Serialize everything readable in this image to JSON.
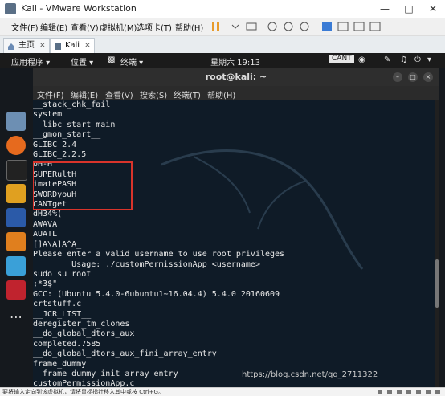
{
  "window": {
    "title": "Kali - VMware Workstation"
  },
  "vm_menu": {
    "items": [
      "文件(F)",
      "编辑(E)",
      "查看(V)",
      "虚拟机(M)",
      "选项卡(T)",
      "帮助(H)"
    ]
  },
  "tabs": [
    {
      "label": "主页"
    },
    {
      "label": "Kali"
    }
  ],
  "kali_panel": {
    "applications": "应用程序 ▾",
    "places": "位置 ▾",
    "terminal": "终端 ▾",
    "clock": "星期六 19:13"
  },
  "terminal": {
    "title": "root@kali: ~",
    "menu": [
      "文件(F)",
      "编辑(E)",
      "查看(V)",
      "搜索(S)",
      "终端(T)",
      "帮助(H)"
    ],
    "lines": [
      "__stack_chk_fail",
      "system",
      "__libc_start_main",
      "__gmon_start__",
      "GLIBC_2.4",
      "GLIBC_2.2.5",
      "UH-H",
      "SUPERultH",
      "imatePASH",
      "SWORDyouH",
      "CANTget",
      "dH34%(",
      "AWAVA",
      "AUATL",
      "[]A\\A]A^A_",
      "Please enter a valid username to use root privileges",
      "        Usage: ./customPermissionApp <username>",
      "sudo su root",
      ";*3$\"",
      "GCC: (Ubuntu 5.4.0-6ubuntu1~16.04.4) 5.4.0 20160609",
      "crtstuff.c",
      "__JCR_LIST__",
      "deregister_tm_clones",
      "__do_global_dtors_aux",
      "completed.7585",
      "__do_global_dtors_aux_fini_array_entry",
      "frame_dummy",
      "__frame_dummy_init_array_entry",
      "customPermissionApp.c"
    ],
    "watermark": "https://blog.csdn.net/qq_2711322"
  },
  "statusbar": {
    "text": "要将输入定向到该虚拟机，请将鼠标指针移入其中或按 Ctrl+G。"
  },
  "colors": {
    "terminal_bg": "#0f1b27",
    "highlight_box": "#d9342b",
    "kali_panel": "#1b1b1b"
  }
}
